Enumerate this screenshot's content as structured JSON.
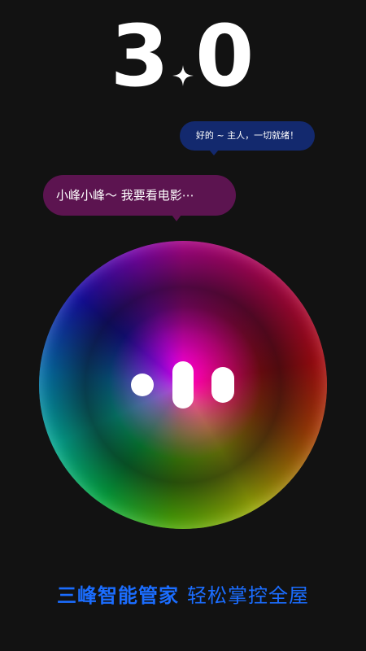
{
  "version": {
    "major": "3",
    "minor": "0"
  },
  "chat": {
    "reply": "好的 ~ 主人，一切就绪！",
    "user_message": "小峰小峰～ 我要看电影⋯"
  },
  "slogan": {
    "brand": "三峰智能管家",
    "tagline": "轻松掌控全屋"
  },
  "colors": {
    "background": "#121212",
    "reply_bubble": "#13296e",
    "user_bubble": "#5c1450",
    "slogan": "#1b6dff"
  },
  "icons": {
    "sparkle": "four-point-star-icon",
    "voice": "voice-wave-icon"
  }
}
